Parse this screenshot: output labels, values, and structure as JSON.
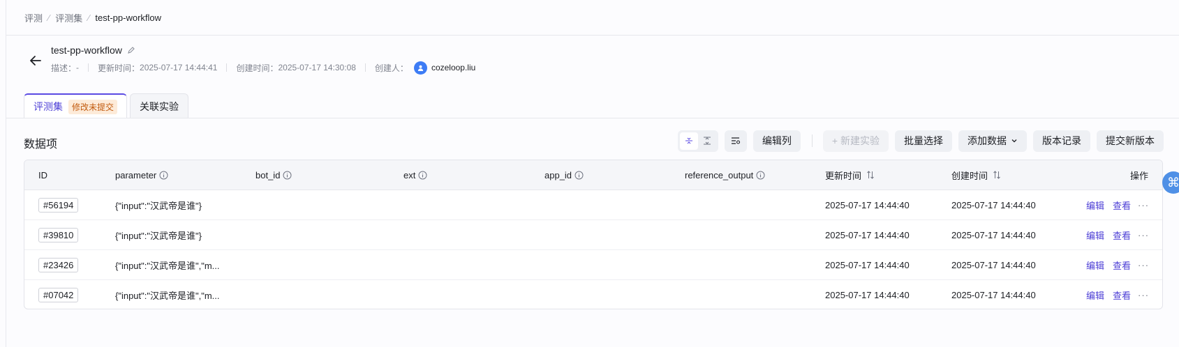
{
  "breadcrumb": [
    "评测",
    "评测集",
    "test-pp-workflow"
  ],
  "header": {
    "title": "test-pp-workflow",
    "desc_label": "描述：",
    "desc_value": "-",
    "updated_label": "更新时间：",
    "updated_value": "2025-07-17 14:44:41",
    "created_label": "创建时间：",
    "created_value": "2025-07-17 14:30:08",
    "creator_label": "创建人：",
    "creator_name": "cozeloop.liu"
  },
  "tabs": [
    {
      "label": "评测集",
      "badge": "修改未提交"
    },
    {
      "label": "关联实验"
    }
  ],
  "section_title": "数据项",
  "toolbar": {
    "edit_columns": "编辑列",
    "new_experiment": "+ 新建实验",
    "batch_select": "批量选择",
    "add_data": "添加数据",
    "version_history": "版本记录",
    "submit_version": "提交新版本"
  },
  "table": {
    "headers": {
      "id": "ID",
      "parameter": "parameter",
      "bot_id": "bot_id",
      "ext": "ext",
      "app_id": "app_id",
      "reference_output": "reference_output",
      "updated": "更新时间",
      "created": "创建时间",
      "actions": "操作"
    },
    "rows": [
      {
        "id": "#56194",
        "parameter": "{\"input\":\"汉武帝是谁\"}",
        "updated": "2025-07-17 14:44:40",
        "created": "2025-07-17 14:44:40"
      },
      {
        "id": "#39810",
        "parameter": "{\"input\":\"汉武帝是谁\"}",
        "updated": "2025-07-17 14:44:40",
        "created": "2025-07-17 14:44:40"
      },
      {
        "id": "#23426",
        "parameter": "{\"input\":\"汉武帝是谁\",\"m...",
        "updated": "2025-07-17 14:44:40",
        "created": "2025-07-17 14:44:40"
      },
      {
        "id": "#07042",
        "parameter": "{\"input\":\"汉武帝是谁\",\"m...",
        "updated": "2025-07-17 14:44:40",
        "created": "2025-07-17 14:44:40"
      }
    ],
    "edit_label": "编辑",
    "view_label": "查看",
    "more_label": "···"
  },
  "floater_icon": "⌘"
}
